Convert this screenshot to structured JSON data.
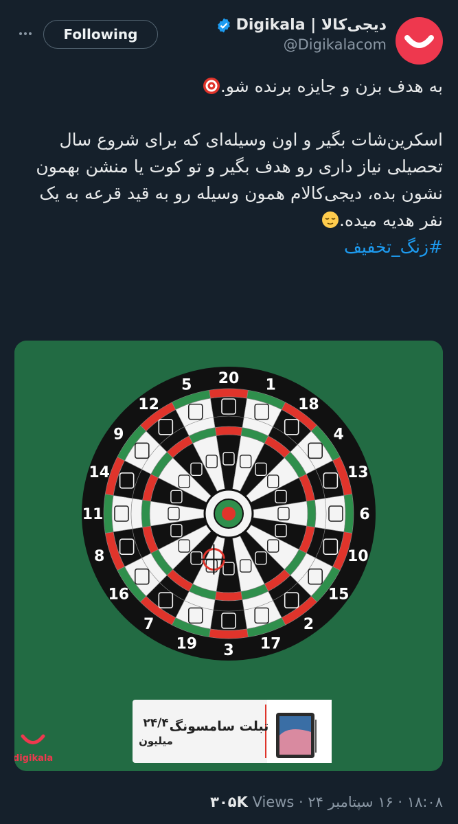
{
  "header": {
    "follow_label": "Following",
    "author_name": "Digikala | دیجی‌کالا",
    "handle": "@Digikalacom"
  },
  "tweet": {
    "line1": "به هدف بزن و جایزه برنده شو.",
    "line2": "اسکرین‌شات بگیر و اون وسیله‌ای که برای شروع سال تحصیلی نیاز داری رو هدف بگیر و تو کوت یا منشن بهمون نشون بده، دیجی‌کالام همون وسیله رو به قید قرعه به یک نفر هدیه میده.",
    "hashtag": "#زنگ_تخفیف",
    "emoji1": "target-emoji",
    "emoji2": "relieved-face-emoji"
  },
  "media": {
    "board_numbers": [
      "20",
      "1",
      "18",
      "4",
      "13",
      "6",
      "10",
      "15",
      "2",
      "17",
      "3",
      "19",
      "7",
      "16",
      "8",
      "11",
      "14",
      "9",
      "12",
      "5"
    ],
    "prize_card": {
      "title": "تبلت سامسونگ",
      "price": "۲۴/۴",
      "unit": "میلیون"
    },
    "watermark": "digikala",
    "colors": {
      "board_green": "#226b43",
      "dart_red": "#e0342b",
      "dart_green": "#2f8f4c",
      "brand_red": "#ee384e"
    }
  },
  "meta": {
    "time": "۱۸:۰۸",
    "date": "۱۶ سپتامبر ۲۴",
    "views_count": "۳۰۵K",
    "views_label": "Views"
  }
}
